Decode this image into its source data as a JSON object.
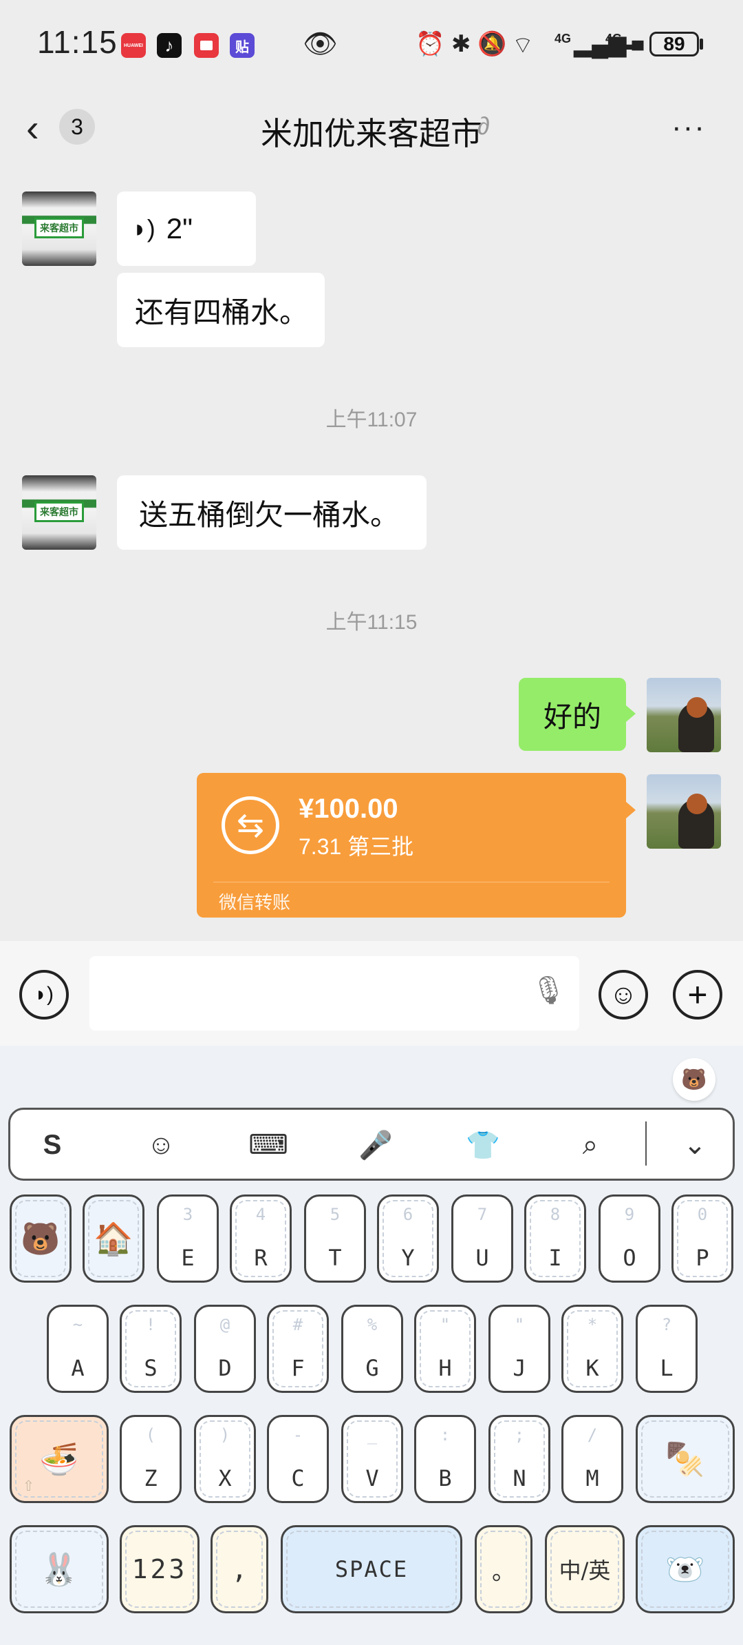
{
  "status_bar": {
    "time": "11:15",
    "huawei_label": "HUAWEI",
    "tie_label": "贴",
    "network1": "4G",
    "network2": "4G",
    "battery": "89"
  },
  "header": {
    "back_count": "3",
    "title": "米加优来客超市"
  },
  "contact": {
    "shop_sign_text": "来客超市"
  },
  "messages": {
    "voice_duration": "2\"",
    "msg1": "还有四桶水。",
    "stamp1": "上午11:07",
    "msg2": "送五桶倒欠一桶水。",
    "stamp2": "上午11:15",
    "msg3": "好的"
  },
  "transfer": {
    "amount": "¥100.00",
    "note": "7.31 第三批",
    "label": "微信转账"
  },
  "input_bar": {
    "placeholder": ""
  },
  "keyboard": {
    "row1": [
      {
        "key": "E",
        "hint": "3"
      },
      {
        "key": "R",
        "hint": "4"
      },
      {
        "key": "T",
        "hint": "5"
      },
      {
        "key": "Y",
        "hint": "6"
      },
      {
        "key": "U",
        "hint": "7"
      },
      {
        "key": "I",
        "hint": "8"
      },
      {
        "key": "O",
        "hint": "9"
      },
      {
        "key": "P",
        "hint": "0"
      }
    ],
    "row2": [
      {
        "key": "A",
        "hint": "~"
      },
      {
        "key": "S",
        "hint": "!"
      },
      {
        "key": "D",
        "hint": "@"
      },
      {
        "key": "F",
        "hint": "#"
      },
      {
        "key": "G",
        "hint": "%"
      },
      {
        "key": "H",
        "hint": "\""
      },
      {
        "key": "J",
        "hint": "\""
      },
      {
        "key": "K",
        "hint": "*"
      },
      {
        "key": "L",
        "hint": "?"
      }
    ],
    "row3": [
      {
        "key": "Z",
        "hint": "("
      },
      {
        "key": "X",
        "hint": ")"
      },
      {
        "key": "C",
        "hint": "-"
      },
      {
        "key": "V",
        "hint": "_"
      },
      {
        "key": "B",
        "hint": ":"
      },
      {
        "key": "N",
        "hint": ";"
      },
      {
        "key": "M",
        "hint": "/"
      }
    ],
    "num_key": "123",
    "comma_key": ",",
    "space_key": "SPACE",
    "period_key": "。",
    "lang_key": "中/英"
  }
}
